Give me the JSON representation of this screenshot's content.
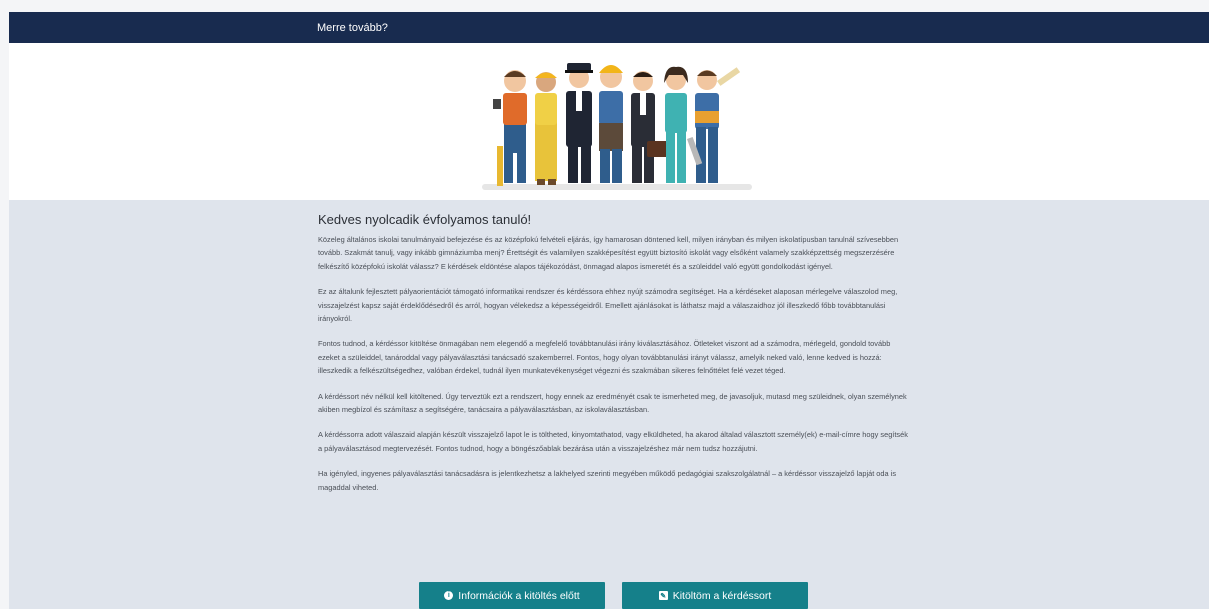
{
  "header": {
    "title": "Merre tovább?"
  },
  "hero": {
    "image_icon": "professions-group-illustration"
  },
  "content": {
    "heading": "Kedves nyolcadik évfolyamos tanuló!",
    "paragraphs": [
      "Közeleg általános iskolai tanulmányaid befejezése és az középfokú felvételi eljárás, így hamarosan döntened kell, milyen irányban és milyen iskolatípusban tanulnál szívesebben tovább. Szakmát tanulj, vagy inkább gimnáziumba menj? Érettségit és valamilyen szakképesítést együtt biztosító iskolát vagy elsőként valamely szakképzettség megszerzésére felkészítő középfokú iskolát válassz? E kérdések eldöntése alapos tájékozódást, önmagad alapos ismeretét és a szüleiddel való együtt gondolkodást igényel.",
      "Ez az általunk fejlesztett pályaorientációt támogató informatikai rendszer és kérdéssora ehhez nyújt számodra segítséget. Ha a kérdéseket alaposan mérlegelve válaszolod meg, visszajelzést kapsz saját érdeklődésedről és arról, hogyan vélekedsz a képességeidről. Emellett ajánlásokat is láthatsz majd a válaszaidhoz jól illeszkedő főbb továbbtanulási irányokról.",
      "Fontos tudnod, a kérdéssor kitöltése önmagában nem elegendő a megfelelő továbbtanulási irány kiválasztásához. Ötleteket viszont ad a számodra, mérlegeld, gondold tovább ezeket a szüleiddel, tanároddal vagy pályaválasztási tanácsadó szakemberrel. Fontos, hogy olyan továbbtanulási irányt válassz, amelyik neked való, lenne kedved is hozzá: illeszkedik a felkészültségedhez, valóban érdekel, tudnál ilyen munkatevékenységet végezni és szakmában sikeres felnőttélet felé vezet téged.",
      "A kérdéssort név nélkül kell kitöltened. Úgy terveztük ezt a rendszert, hogy ennek az eredményét csak te ismerheted meg, de javasoljuk, mutasd meg szüleidnek, olyan személynek akiben megbízol és számítasz a segítségére, tanácsaira a pályaválasztásban, az iskolaválasztásban.",
      "A kérdéssorra adott válaszaid alapján készült visszajelző lapot le is töltheted, kinyomtathatod, vagy elküldheted, ha akarod általad választott személy(ek) e-mail-címre hogy segítsék a pályaválasztásod megtervezését. Fontos tudnod, hogy a böngészőablak bezárása után a visszajelzéshez már nem tudsz hozzájutni.",
      "Ha igényled, ingyenes pályaválasztási tanácsadásra is jelentkezhetsz a lakhelyed szerinti megyében működő pedagógiai szakszolgálatnál – a kérdéssor visszajelző lapját oda is magaddal viheted."
    ]
  },
  "buttons": {
    "info": {
      "label": "Információk a kitöltés előtt",
      "icon": "info-circle-icon",
      "glyph": "i"
    },
    "fill": {
      "label": "Kitöltöm a kérdéssort",
      "icon": "edit-square-icon",
      "glyph": "✎"
    }
  },
  "colors": {
    "header_bg": "#182b4f",
    "page_bg": "#dfe4ec",
    "button_bg": "#15808a"
  }
}
